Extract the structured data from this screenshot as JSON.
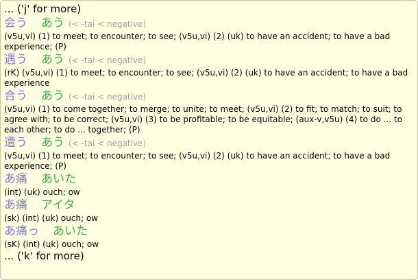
{
  "nav": {
    "prev": "... ('j' for more)",
    "next": "... ('k' for more)"
  },
  "entries": [
    {
      "kanji": "会う",
      "kana": "あう",
      "conj": "(< -tai < negative)",
      "def": "(v5u,vi) (1) to meet; to encounter; to see; (v5u,vi) (2) (uk) to have an accident; to have a bad experience; (P)"
    },
    {
      "kanji": "遇う",
      "kana": "あう",
      "conj": "(< -tai < negative)",
      "def": "(rK) (v5u,vi) (1) to meet; to encounter; to see; (v5u,vi) (2) (uk) to have an accident; to have a bad experience"
    },
    {
      "kanji": "合う",
      "kana": "あう",
      "conj": "(< -tai < negative)",
      "def": "(v5u,vi) (1) to come together; to merge; to unite; to meet; (v5u,vi) (2) to fit; to match; to suit; to agree with; to be correct; (v5u,vi) (3) to be profitable; to be equitable; (aux-v,v5u) (4) to do ... to each other; to do ... together; (P)"
    },
    {
      "kanji": "遭う",
      "kana": "あう",
      "conj": "(< -tai < negative)",
      "def": "(v5u,vi) (1) to meet; to encounter; to see; (v5u,vi) (2) (uk) to have an accident; to have a bad experience; (P)"
    },
    {
      "kanji": "あ痛",
      "kana": "あいた",
      "conj": "",
      "def": "(int) (uk) ouch; ow"
    },
    {
      "kanji": "あ痛",
      "kana": "アイタ",
      "conj": "",
      "def": "(sk) (int) (uk) ouch; ow"
    },
    {
      "kanji": "あ痛っ",
      "kana": "あいた",
      "conj": "",
      "def": "(sK) (int) (uk) ouch; ow"
    }
  ],
  "colors": {
    "background": "#ffffe1",
    "kanji": "#8080e0",
    "kana": "#40b040",
    "conj": "#a0a0a0"
  }
}
